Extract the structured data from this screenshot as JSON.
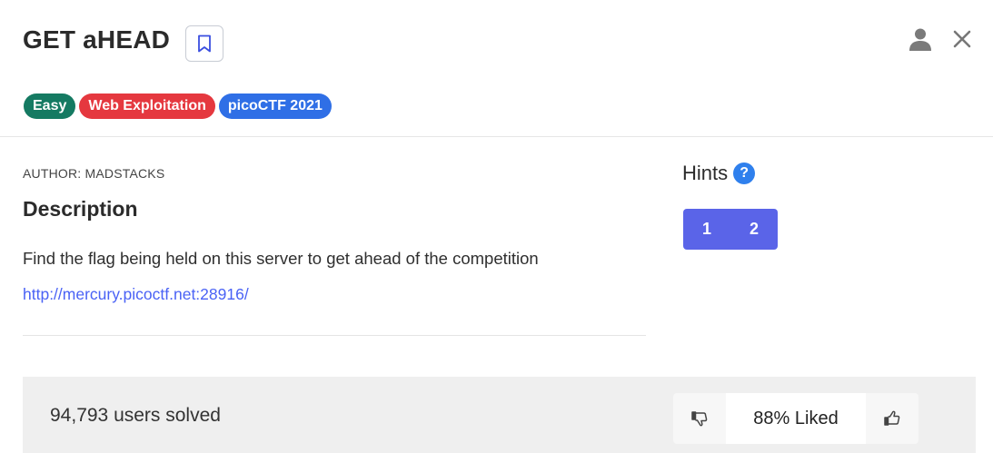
{
  "challenge": {
    "title": "GET aHEAD",
    "tags": [
      {
        "label": "Easy",
        "color": "#157a62"
      },
      {
        "label": "Web Exploitation",
        "color": "#e5383f"
      },
      {
        "label": "picoCTF 2021",
        "color": "#2f6fe6"
      }
    ],
    "author": "AUTHOR: MADSTACKS",
    "description_heading": "Description",
    "description_text": "Find the flag being held on this server to get ahead of the competition",
    "link": "http://mercury.picoctf.net:28916/"
  },
  "icons": {
    "bookmark": "bookmark-icon",
    "user": "user-icon",
    "close": "close-icon",
    "help": "question-circle-icon",
    "thumbs_down": "thumbs-down-icon",
    "thumbs_up": "thumbs-up-icon"
  },
  "hints": {
    "heading": "Hints",
    "help_glyph": "?",
    "buttons": [
      "1",
      "2"
    ]
  },
  "footer": {
    "solved": "94,793 users solved",
    "liked": "88% Liked"
  },
  "colors": {
    "hint_button": "#5a64e8",
    "link": "#4a62f5",
    "help_icon": "#2f80ed"
  }
}
